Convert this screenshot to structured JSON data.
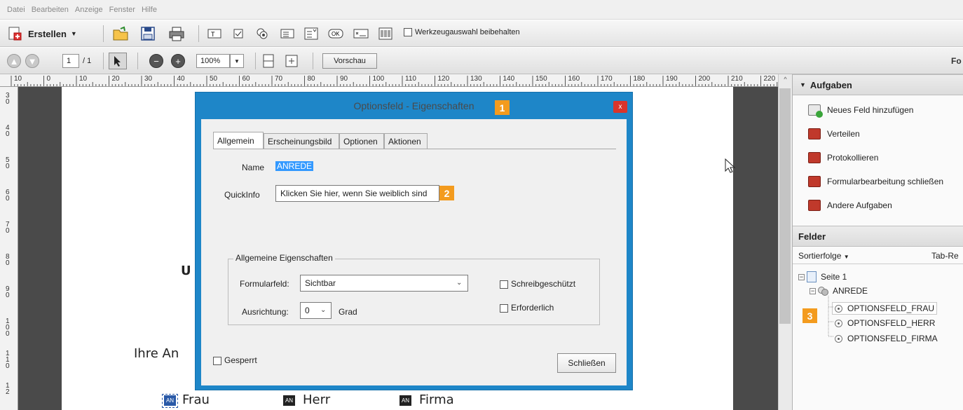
{
  "menu": [
    "Datei",
    "Bearbeiten",
    "Anzeige",
    "Fenster",
    "Hilfe"
  ],
  "toolbar": {
    "create_label": "Erstellen",
    "keep_tool_label": "Werkzeugauswahl beibehalten",
    "page_current": "1",
    "page_total": "/ 1",
    "zoom": "100%",
    "preview_label": "Vorschau",
    "right_cut": "Fo"
  },
  "ruler": {
    "h_ticks": [
      "10",
      "0",
      "10",
      "20",
      "30",
      "40",
      "50",
      "60",
      "70",
      "80",
      "90",
      "100",
      "110",
      "120",
      "130",
      "140",
      "150",
      "160",
      "170",
      "180",
      "190",
      "200",
      "210",
      "220"
    ],
    "v_ticks": [
      "3\n0",
      "4\n0",
      "5\n0",
      "6\n0",
      "7\n0",
      "8\n0",
      "9\n0",
      "1\n0\n0",
      "1\n1\n0",
      "1\n2"
    ]
  },
  "document": {
    "heading_cut": "U",
    "ihre_cut": "Ihre An",
    "options": [
      "Frau",
      "Herr",
      "Firma"
    ],
    "an_icon": "AN"
  },
  "dialog": {
    "title": "Optionsfeld - Eigenschaften",
    "close": "x",
    "tabs": [
      "Allgemein",
      "Erscheinungsbild",
      "Optionen",
      "Aktionen"
    ],
    "name_label": "Name",
    "name_value": "ANREDE",
    "quickinfo_label": "QuickInfo",
    "quickinfo_value": "Klicken Sie hier, wenn Sie weiblich sind",
    "group_title": "Allgemeine Eigenschaften",
    "formfield_label": "Formularfeld:",
    "formfield_value": "Sichtbar",
    "readonly_label": "Schreibgeschützt",
    "orientation_label": "Ausrichtung:",
    "orientation_value": "0",
    "degree_label": "Grad",
    "required_label": "Erforderlich",
    "locked_label": "Gesperrt",
    "close_button": "Schließen"
  },
  "badges": [
    "1",
    "2",
    "3"
  ],
  "panel": {
    "tasks_title": "Aufgaben",
    "tasks": [
      "Neues Feld hinzufügen",
      "Verteilen",
      "Protokollieren",
      "Formularbearbeitung schließen",
      "Andere Aufgaben"
    ],
    "fields_title": "Felder",
    "sort_label": "Sortierfolge",
    "tab_cut": "Tab-Re",
    "tree_page": "Seite 1",
    "tree_group": "ANREDE",
    "tree_items": [
      "OPTIONSFELD_FRAU",
      "OPTIONSFELD_HERR",
      "OPTIONSFELD_FIRMA"
    ]
  },
  "colors": {
    "dialog_blue": "#1e86c8",
    "badge_orange": "#f39b1e",
    "selection_blue": "#3399ff"
  }
}
